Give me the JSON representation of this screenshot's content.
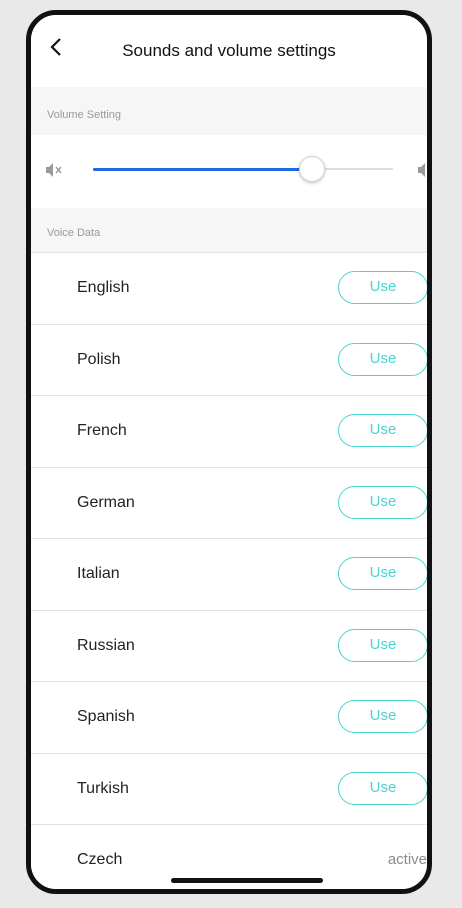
{
  "header": {
    "title": "Sounds and volume settings",
    "back_icon": "chevron-left-icon"
  },
  "volume": {
    "section_label": "Volume Setting",
    "level": 0.73,
    "mute_icon": "speaker-mute-icon",
    "loud_icon": "speaker-loud-icon",
    "accent_color": "#1e67e6"
  },
  "voice": {
    "section_label": "Voice Data",
    "use_color": "#48d4d0",
    "items": [
      {
        "name": "English",
        "action": "Use"
      },
      {
        "name": "Polish",
        "action": "Use"
      },
      {
        "name": "French",
        "action": "Use"
      },
      {
        "name": "German",
        "action": "Use"
      },
      {
        "name": "Italian",
        "action": "Use"
      },
      {
        "name": "Russian",
        "action": "Use"
      },
      {
        "name": "Spanish",
        "action": "Use"
      },
      {
        "name": "Turkish",
        "action": "Use"
      },
      {
        "name": "Czech",
        "status": "active"
      }
    ]
  }
}
